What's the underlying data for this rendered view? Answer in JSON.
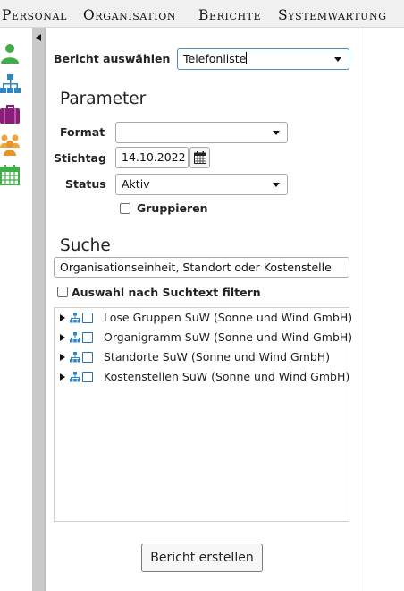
{
  "menu": {
    "personal": "Personal",
    "organisation": "Organisation",
    "berichte": "Berichte",
    "systemwartung": "Systemwartung"
  },
  "sidebar_icons": [
    "person-icon",
    "org-chart-icon",
    "briefcase-icon",
    "group-icon",
    "calendar-icon"
  ],
  "colors": {
    "person": "#3fae49",
    "orgchart": "#2f86c4",
    "briefcase": "#8b1d7a",
    "group": "#f0a53a",
    "calendar": "#3fae49",
    "tree_icon": "#2f86c4"
  },
  "report": {
    "label": "Bericht auswählen",
    "selected": "Telefonliste"
  },
  "parameters": {
    "title": "Parameter",
    "format_label": "Format",
    "format_value": "",
    "stichtag_label": "Stichtag",
    "stichtag_value": "14.10.2022",
    "status_label": "Status",
    "status_value": "Aktiv",
    "group_label": "Gruppieren",
    "group_checked": false
  },
  "search": {
    "title": "Suche",
    "placeholder": "Organisationseinheit, Standort oder Kostenstelle",
    "filter_label": "Auswahl nach Suchtext filtern",
    "filter_checked": false
  },
  "tree": [
    {
      "label": "Lose Gruppen SuW (Sonne und Wind GmbH)"
    },
    {
      "label": "Organigramm SuW (Sonne und Wind GmbH)"
    },
    {
      "label": "Standorte SuW (Sonne und Wind GmbH)"
    },
    {
      "label": "Kostenstellen SuW (Sonne und Wind GmbH)"
    }
  ],
  "actions": {
    "create_report": "Bericht erstellen"
  }
}
